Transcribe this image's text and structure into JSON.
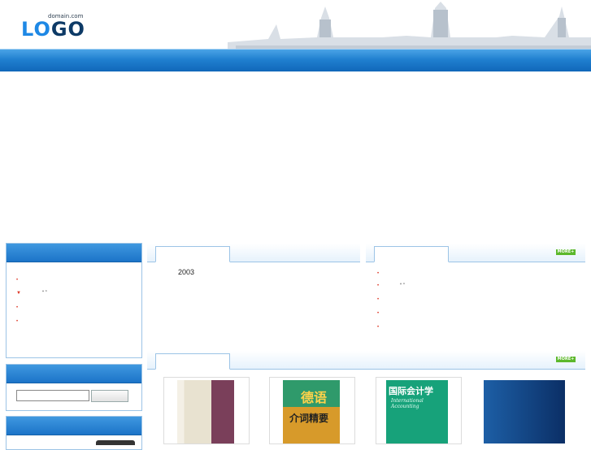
{
  "header": {
    "logo": {
      "domain": "domain.com",
      "text_lo": "LO",
      "text_go": "GO"
    }
  },
  "left": {
    "notice_items": [
      {
        "bullet": "•",
        "text": ""
      },
      {
        "bullet": "▼",
        "text": "“ ”"
      },
      {
        "bullet": "•",
        "text": ""
      },
      {
        "bullet": "•",
        "text": ""
      }
    ],
    "search": {
      "input_value": "",
      "button_label": ""
    }
  },
  "panels": {
    "intro": {
      "title": "",
      "year_text": "2003"
    },
    "news": {
      "title": "",
      "more_label": "MORE+",
      "items": [
        {
          "bullet": "•",
          "text": ""
        },
        {
          "bullet": "•",
          "text": "“ ”"
        },
        {
          "bullet": "•",
          "text": ""
        },
        {
          "bullet": "•",
          "text": ""
        },
        {
          "bullet": "•",
          "text": ""
        }
      ]
    },
    "books": {
      "title": "",
      "more_label": "MORE+",
      "items": [
        {
          "cover_title": "",
          "cover_sub": ""
        },
        {
          "cover_big": "德语",
          "cover_title": "介词精要"
        },
        {
          "cover_title": "国际会计学",
          "cover_sub": "International Accounting"
        },
        {
          "cover_title": ""
        }
      ]
    }
  },
  "colors": {
    "accent": "#1f7fcf",
    "more_badge": "#5cb82c",
    "bullet": "#dd3322"
  },
  "icons": {
    "more": "more-badge-icon",
    "bullet": "red-bullet-icon"
  }
}
